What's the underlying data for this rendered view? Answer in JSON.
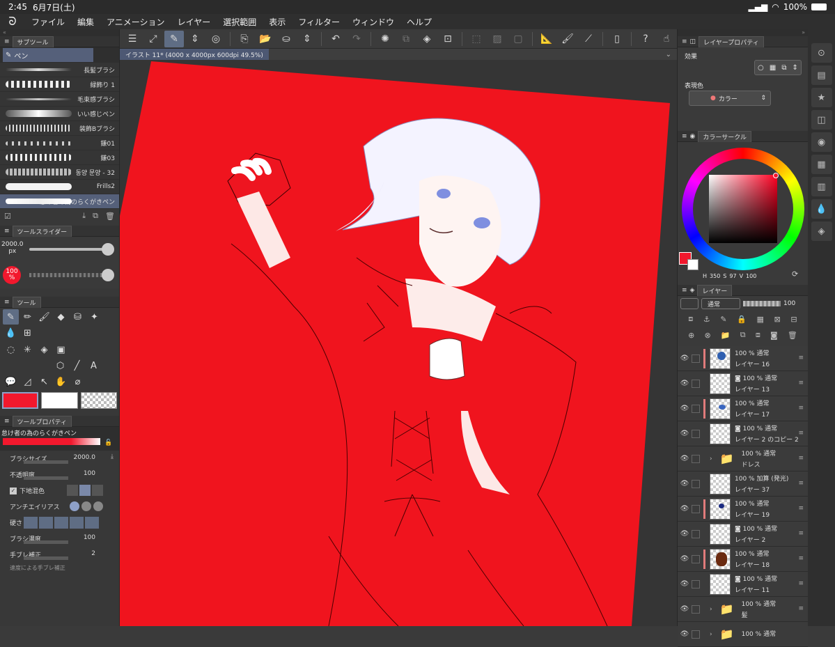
{
  "status": {
    "time": "2:45",
    "date": "6月7日(土)",
    "battery": "100%"
  },
  "menu": [
    "ファイル",
    "編集",
    "アニメーション",
    "レイヤー",
    "選択範囲",
    "表示",
    "フィルター",
    "ウィンドウ",
    "ヘルプ"
  ],
  "doc_tab": "イラスト 11* (4000 x 4000px 600dpi 49.5%)",
  "subtool": {
    "tab": "サブツール",
    "group": "ペン",
    "brushes": [
      "長髪ブラシ",
      "緑飾り 1",
      "毛束感ブラシ",
      "いい感じペン",
      "装飾Bブラシ",
      "鎌01",
      "鎌03",
      "동양 문양 - 32",
      "Frills2",
      "怠け者の為のらくがきペン"
    ]
  },
  "tool_slider": {
    "tab": "ツールスライダー",
    "size": "2000.0",
    "size_unit": "px",
    "opacity": "100",
    "opacity_unit": "%"
  },
  "tools_tab": "ツール",
  "tool_property": {
    "tab": "ツールプロパティ",
    "brush_name": "怠け者の為のらくがきペン",
    "brush_size_label": "ブラシサイズ",
    "brush_size": "2000.0",
    "opacity_label": "不透明度",
    "opacity": "100",
    "blend_label": "下地混色",
    "antialias_label": "アンチエイリアス",
    "hardness_label": "硬さ",
    "density_label": "ブラシ濃度",
    "density": "100",
    "stabilize_label": "手ブレ補正",
    "stabilize": "2",
    "bottom_label": "速度による手ブレ補正"
  },
  "layer_property": {
    "tab": "レイヤープロパティ",
    "effect_label": "効果",
    "color_label": "表現色",
    "color_value": "カラー"
  },
  "color_circle": {
    "tab": "カラーサークル",
    "h_label": "H",
    "h": "350",
    "s_label": "S",
    "s": "97",
    "v_label": "V",
    "v": "100",
    "main_color": "#f2182d"
  },
  "layers_panel": {
    "tab": "レイヤー",
    "blend": "通常",
    "opacity": "100"
  },
  "layers": [
    {
      "pct": "100 %",
      "mode": "通常",
      "name": "レイヤー 16",
      "kind": "paint",
      "mark": true
    },
    {
      "pct": "100 %",
      "mode": "通常",
      "name": "レイヤー 13",
      "kind": "ref",
      "mark": false
    },
    {
      "pct": "100 %",
      "mode": "通常",
      "name": "レイヤー 17",
      "kind": "paint",
      "mark": true
    },
    {
      "pct": "100 %",
      "mode": "通常",
      "name": "レイヤー 2 のコピー 2",
      "kind": "ref",
      "mark": false
    },
    {
      "pct": "100 %",
      "mode": "通常",
      "name": "ドレス",
      "kind": "folder",
      "mark": false
    },
    {
      "pct": "100 %",
      "mode": "加算 (発光)",
      "name": "レイヤー 37",
      "kind": "plain",
      "mark": false
    },
    {
      "pct": "100 %",
      "mode": "通常",
      "name": "レイヤー 19",
      "kind": "paint",
      "mark": true
    },
    {
      "pct": "100 %",
      "mode": "通常",
      "name": "レイヤー 2",
      "kind": "ref",
      "mark": false
    },
    {
      "pct": "100 %",
      "mode": "通常",
      "name": "レイヤー 18",
      "kind": "paint",
      "mark": true
    },
    {
      "pct": "100 %",
      "mode": "通常",
      "name": "レイヤー 11",
      "kind": "ref",
      "mark": false
    },
    {
      "pct": "100 %",
      "mode": "通常",
      "name": "髪",
      "kind": "folder",
      "mark": false
    },
    {
      "pct": "100 %",
      "mode": "通常",
      "name": "",
      "kind": "folder",
      "mark": false
    }
  ],
  "colors": {
    "canvas_red": "#f0141e",
    "accent": "#5f6d84"
  }
}
